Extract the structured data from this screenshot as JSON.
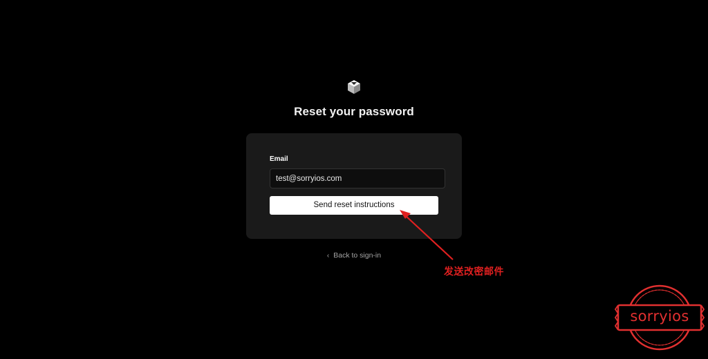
{
  "page": {
    "title": "Reset your password",
    "logo_icon": "cube-logo-icon"
  },
  "form": {
    "email_label": "Email",
    "email_value": "test@sorryios.com",
    "email_placeholder": "",
    "submit_label": "Send reset instructions"
  },
  "back_link": {
    "icon": "chevron-left-icon",
    "label": "Back to sign-in"
  },
  "annotation": {
    "text": "发送改密邮件",
    "color": "#e02020"
  },
  "watermark": {
    "text": "sorryios",
    "color": "#e23030"
  },
  "colors": {
    "background": "#000000",
    "card": "#1a1a1a",
    "button": "#ffffff",
    "input_background": "#0e0e0e"
  }
}
